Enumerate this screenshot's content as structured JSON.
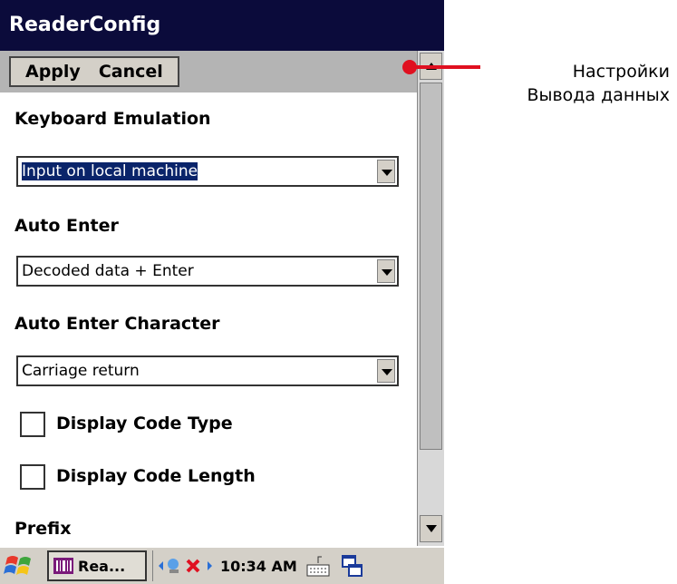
{
  "window": {
    "title": "ReaderConfig"
  },
  "menu": {
    "apply": "Apply",
    "cancel": "Cancel"
  },
  "fields": {
    "keyboard_emulation": {
      "label": "Keyboard Emulation",
      "value": "Input on local machine"
    },
    "auto_enter": {
      "label": "Auto Enter",
      "value": "Decoded data + Enter"
    },
    "auto_enter_character": {
      "label": "Auto Enter Character",
      "value": "Carriage return"
    },
    "display_code_type": {
      "label": "Display Code Type",
      "checked": false
    },
    "display_code_length": {
      "label": "Display Code Length",
      "checked": false
    },
    "prefix": {
      "label": "Prefix"
    }
  },
  "taskbar": {
    "app_label": "Rea...",
    "time": "10:34 AM"
  },
  "annotation": {
    "line1": "Настройки",
    "line2": "Вывода данных"
  },
  "colors": {
    "titlebar": "#0b0b3b",
    "selection": "#0a246a",
    "annotation_accent": "#e01020"
  },
  "icons": [
    "windows-start-icon",
    "app-icon",
    "network-icon",
    "keyboard-icon",
    "window-switch-icon",
    "dropdown-arrow-icon",
    "scroll-up-icon",
    "scroll-down-icon"
  ]
}
